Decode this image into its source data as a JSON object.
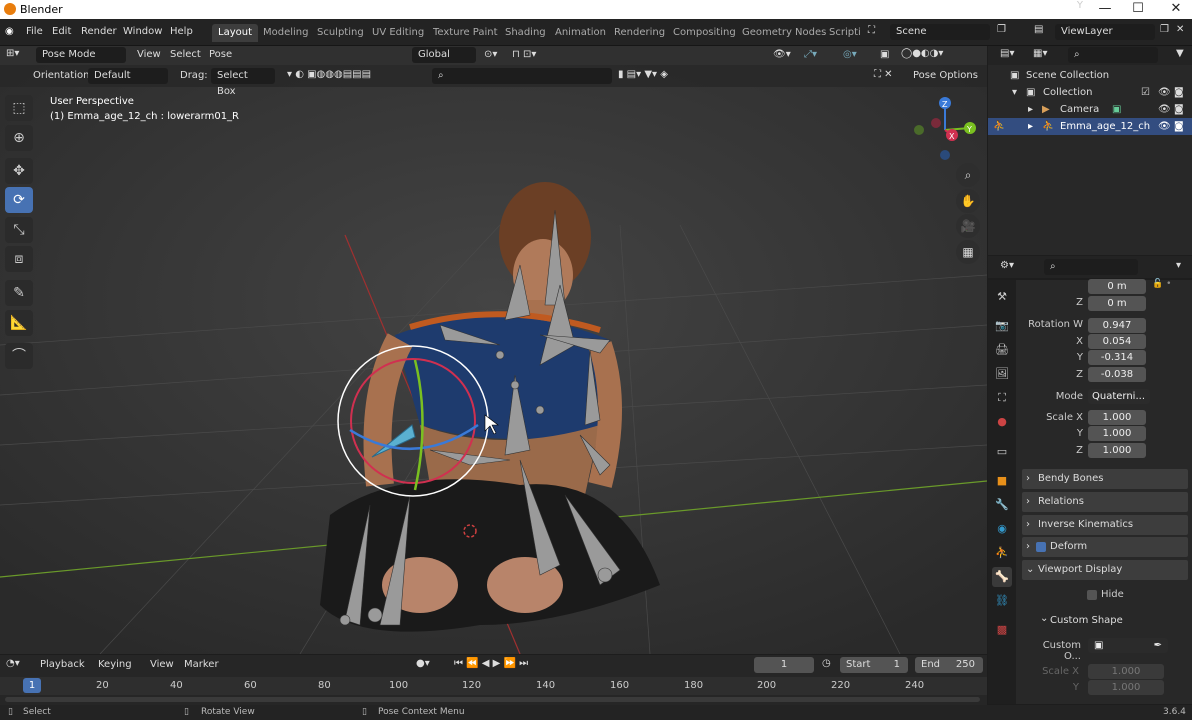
{
  "window": {
    "title": "Blender",
    "minimize": "—",
    "maximize": "☐",
    "close": "✕"
  },
  "menu": [
    "File",
    "Edit",
    "Render",
    "Window",
    "Help"
  ],
  "workspaces": [
    "Layout",
    "Modeling",
    "Sculpting",
    "UV Editing",
    "Texture Paint",
    "Shading",
    "Animation",
    "Rendering",
    "Compositing",
    "Geometry Nodes",
    "Scripti"
  ],
  "scene": {
    "label": "Scene",
    "viewlayer": "ViewLayer"
  },
  "header": {
    "mode": "Pose Mode",
    "view": "View",
    "select": "Select",
    "pose": "Pose",
    "transform": "Global",
    "orientation_label": "Orientation:",
    "orientation_value": "Default",
    "drag_label": "Drag:",
    "drag_value": "Select Box",
    "pose_options": "Pose Options"
  },
  "viewport": {
    "perspective": "User Perspective",
    "object_info": "(1) Emma_age_12_ch : lowerarm01_R",
    "gizmo_axes": [
      "Z",
      "Y",
      "X"
    ]
  },
  "outliner": {
    "scene_collection": "Scene Collection",
    "collection": "Collection",
    "camera": "Camera",
    "character": "Emma_age_12_ch"
  },
  "properties": {
    "y_label": "Y",
    "y_value": "0 m",
    "z_label": "Z",
    "z_value": "0 m",
    "rot_w_label": "Rotation W",
    "rot_w": "0.947",
    "rot_x_label": "X",
    "rot_x": "0.054",
    "rot_y_label": "Y",
    "rot_y": "-0.314",
    "rot_z_label": "Z",
    "rot_z": "-0.038",
    "mode_label": "Mode",
    "mode_value": "Quaterni...",
    "scale_x_label": "Scale X",
    "scale_x": "1.000",
    "scale_y_label": "Y",
    "scale_y": "1.000",
    "scale_z_label": "Z",
    "scale_z": "1.000",
    "panels": [
      "Bendy Bones",
      "Relations",
      "Inverse Kinematics",
      "Deform",
      "Viewport Display"
    ],
    "hide_label": "Hide",
    "custom_shape": "Custom Shape",
    "custom_object_label": "Custom O...",
    "cs_scale_x_label": "Scale X",
    "cs_scale_x": "1.000",
    "cs_scale_y_label": "Y",
    "cs_scale_y": "1.000"
  },
  "timeline": {
    "menu": [
      "Playback",
      "Keying",
      "View",
      "Marker"
    ],
    "current_frame": "1",
    "start_label": "Start",
    "start": "1",
    "end_label": "End",
    "end": "250",
    "cursor_frame": "1",
    "ticks": [
      "20",
      "40",
      "60",
      "80",
      "100",
      "120",
      "140",
      "160",
      "180",
      "200",
      "220",
      "240"
    ]
  },
  "status": {
    "select": "Select",
    "rotate": "Rotate View",
    "context": "Pose Context Menu",
    "version": "3.6.4"
  }
}
